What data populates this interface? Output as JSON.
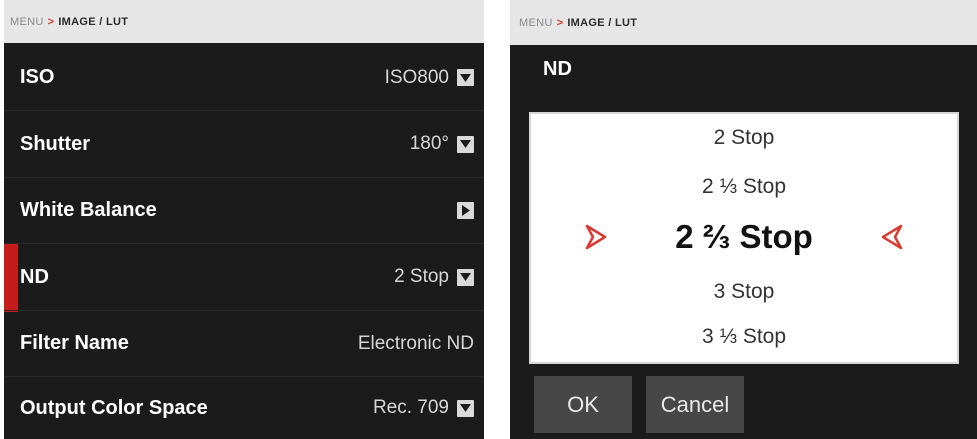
{
  "left_panel": {
    "breadcrumb": {
      "root": "MENU",
      "separator": ">",
      "current": "IMAGE / LUT"
    },
    "rows": [
      {
        "label": "ISO",
        "value": "ISO800",
        "dropdown_icon": "chevron-down-icon"
      },
      {
        "label": "Shutter",
        "value": "180°",
        "dropdown_icon": "chevron-down-icon"
      },
      {
        "label": "White Balance",
        "value": "",
        "dropdown_icon": "chevron-right-icon"
      },
      {
        "label": "ND",
        "value": "2 Stop",
        "dropdown_icon": "chevron-down-icon",
        "selected": true
      },
      {
        "label": "Filter Name",
        "value": "Electronic ND"
      },
      {
        "label": "Output Color Space",
        "value": "Rec. 709",
        "dropdown_icon": "chevron-down-icon"
      }
    ],
    "selection_color": "#c61b1b"
  },
  "right_panel": {
    "breadcrumb": {
      "root": "MENU",
      "separator": ">",
      "current": "IMAGE / LUT"
    },
    "title": "ND",
    "picker": {
      "options": [
        "2 Stop",
        "2 ⅓ Stop",
        "2 ⅔ Stop",
        "3 Stop",
        "3 ⅓ Stop"
      ],
      "selected": "2 ⅔ Stop",
      "arrow_color": "#d9392f"
    },
    "buttons": {
      "ok": "OK",
      "cancel": "Cancel"
    }
  }
}
